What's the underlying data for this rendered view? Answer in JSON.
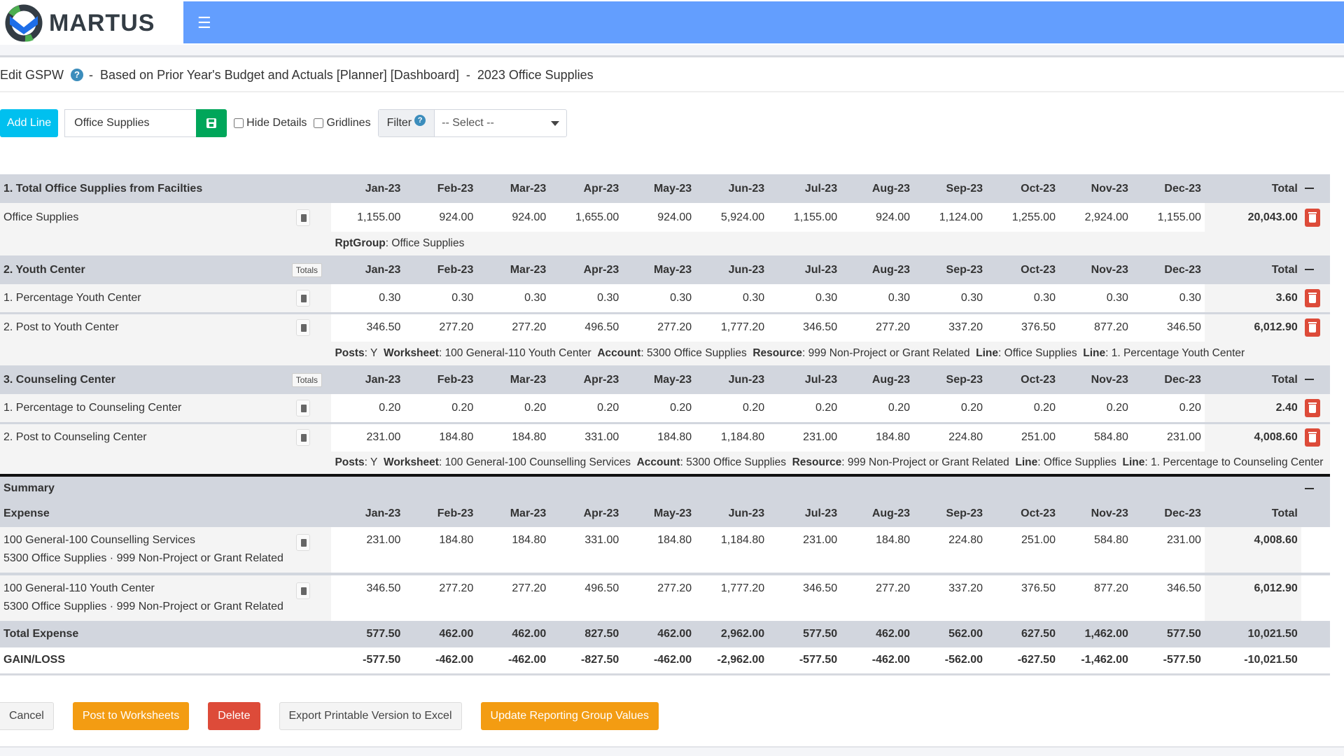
{
  "brand": {
    "name": "MARTUS",
    "menu_icon": "hamburger-icon"
  },
  "title": {
    "prefix": "Edit GSPW",
    "sep1": "-",
    "description": "Based on Prior Year's Budget and Actuals [Planner] [Dashboard]",
    "sep2": "-",
    "name": "2023 Office Supplies"
  },
  "toolbar": {
    "add_line": "Add Line",
    "name_value": "Office Supplies",
    "hide_details": "Hide Details",
    "gridlines": "Gridlines",
    "filter_label": "Filter",
    "filter_select": "-- Select --"
  },
  "months": [
    "Jan-23",
    "Feb-23",
    "Mar-23",
    "Apr-23",
    "May-23",
    "Jun-23",
    "Jul-23",
    "Aug-23",
    "Sep-23",
    "Oct-23",
    "Nov-23",
    "Dec-23"
  ],
  "total_label": "Total",
  "totals_tag": "Totals",
  "sections": [
    {
      "title": "1. Total Office Supplies from Facilties",
      "has_totals_tag": false,
      "lines": [
        {
          "label": "Office Supplies",
          "values": [
            "1,155.00",
            "924.00",
            "924.00",
            "1,655.00",
            "924.00",
            "5,924.00",
            "1,155.00",
            "924.00",
            "1,124.00",
            "1,255.00",
            "2,924.00",
            "1,155.00"
          ],
          "total": "20,043.00"
        }
      ],
      "detail": [
        {
          "k": "RptGroup",
          "v": "Office Supplies"
        }
      ]
    },
    {
      "title": "2. Youth Center",
      "has_totals_tag": true,
      "lines": [
        {
          "label": "1. Percentage Youth Center",
          "values": [
            "0.30",
            "0.30",
            "0.30",
            "0.30",
            "0.30",
            "0.30",
            "0.30",
            "0.30",
            "0.30",
            "0.30",
            "0.30",
            "0.30"
          ],
          "total": "3.60"
        },
        {
          "label": "2. Post to Youth Center",
          "values": [
            "346.50",
            "277.20",
            "277.20",
            "496.50",
            "277.20",
            "1,777.20",
            "346.50",
            "277.20",
            "337.20",
            "376.50",
            "877.20",
            "346.50"
          ],
          "total": "6,012.90"
        }
      ],
      "detail": [
        {
          "k": "Posts",
          "v": "Y"
        },
        {
          "k": "Worksheet",
          "v": "100 General-110 Youth Center"
        },
        {
          "k": "Account",
          "v": "5300 Office Supplies"
        },
        {
          "k": "Resource",
          "v": "999 Non-Project or Grant Related"
        },
        {
          "k": "Line",
          "v": "Office Supplies"
        },
        {
          "k": "Line",
          "v": "1. Percentage Youth Center"
        }
      ]
    },
    {
      "title": "3. Counseling Center",
      "has_totals_tag": true,
      "lines": [
        {
          "label": "1. Percentage to Counseling Center",
          "values": [
            "0.20",
            "0.20",
            "0.20",
            "0.20",
            "0.20",
            "0.20",
            "0.20",
            "0.20",
            "0.20",
            "0.20",
            "0.20",
            "0.20"
          ],
          "total": "2.40"
        },
        {
          "label": "2. Post to Counseling Center",
          "values": [
            "231.00",
            "184.80",
            "184.80",
            "331.00",
            "184.80",
            "1,184.80",
            "231.00",
            "184.80",
            "224.80",
            "251.00",
            "584.80",
            "231.00"
          ],
          "total": "4,008.60"
        }
      ],
      "detail": [
        {
          "k": "Posts",
          "v": "Y"
        },
        {
          "k": "Worksheet",
          "v": "100 General-100 Counselling Services"
        },
        {
          "k": "Account",
          "v": "5300 Office Supplies"
        },
        {
          "k": "Resource",
          "v": "999 Non-Project or Grant Related"
        },
        {
          "k": "Line",
          "v": "Office Supplies"
        },
        {
          "k": "Line",
          "v": "1. Percentage to Counseling Center"
        }
      ]
    }
  ],
  "summary": {
    "title": "Summary",
    "expense_label": "Expense",
    "rows": [
      {
        "line1": "100 General-100 Counselling Services",
        "line2": "5300 Office Supplies · 999 Non-Project or Grant Related",
        "values": [
          "231.00",
          "184.80",
          "184.80",
          "331.00",
          "184.80",
          "1,184.80",
          "231.00",
          "184.80",
          "224.80",
          "251.00",
          "584.80",
          "231.00"
        ],
        "total": "4,008.60"
      },
      {
        "line1": "100 General-110 Youth Center",
        "line2": "5300 Office Supplies · 999 Non-Project or Grant Related",
        "values": [
          "346.50",
          "277.20",
          "277.20",
          "496.50",
          "277.20",
          "1,777.20",
          "346.50",
          "277.20",
          "337.20",
          "376.50",
          "877.20",
          "346.50"
        ],
        "total": "6,012.90"
      }
    ],
    "total_expense": {
      "label": "Total Expense",
      "values": [
        "577.50",
        "462.00",
        "462.00",
        "827.50",
        "462.00",
        "2,962.00",
        "577.50",
        "462.00",
        "562.00",
        "627.50",
        "1,462.00",
        "577.50"
      ],
      "total": "10,021.50"
    },
    "gain_loss": {
      "label": "GAIN/LOSS",
      "values": [
        "-577.50",
        "-462.00",
        "-462.00",
        "-827.50",
        "-462.00",
        "-2,962.00",
        "-577.50",
        "-462.00",
        "-562.00",
        "-627.50",
        "-1,462.00",
        "-577.50"
      ],
      "total": "-10,021.50"
    }
  },
  "footer": {
    "cancel": "Cancel",
    "post": "Post to Worksheets",
    "delete": "Delete",
    "export": "Export Printable Version to Excel",
    "update": "Update Reporting Group Values"
  },
  "colors": {
    "navbar": "#639efe",
    "info": "#00c0ef",
    "success": "#00a65a",
    "warning": "#f39c12",
    "danger": "#dd4b39",
    "header_gray": "#d2d6de"
  }
}
